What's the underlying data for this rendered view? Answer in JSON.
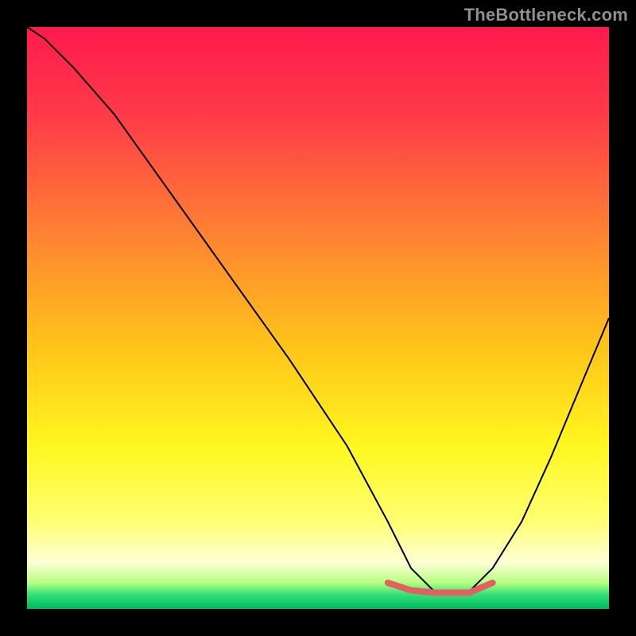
{
  "watermark": "TheBottleneck.com",
  "chart_data": {
    "type": "line",
    "title": "",
    "xlabel": "",
    "ylabel": "",
    "xlim": [
      0,
      100
    ],
    "ylim": [
      0,
      100
    ],
    "background_gradient": {
      "stops": [
        {
          "offset": 0.0,
          "color": "#ff1a4d"
        },
        {
          "offset": 0.15,
          "color": "#ff3a49"
        },
        {
          "offset": 0.35,
          "color": "#ff8033"
        },
        {
          "offset": 0.55,
          "color": "#ffc41a"
        },
        {
          "offset": 0.72,
          "color": "#fff71f"
        },
        {
          "offset": 0.85,
          "color": "#ffff73"
        },
        {
          "offset": 0.92,
          "color": "#ffffd6"
        },
        {
          "offset": 0.955,
          "color": "#b6ff80"
        },
        {
          "offset": 0.975,
          "color": "#33e07a"
        },
        {
          "offset": 1.0,
          "color": "#00b85c"
        }
      ]
    },
    "series": [
      {
        "name": "bottleneck-curve",
        "color": "#000000",
        "width": 2,
        "x": [
          0,
          3,
          8,
          15,
          25,
          35,
          45,
          55,
          62,
          66,
          70,
          76,
          80,
          85,
          90,
          95,
          100
        ],
        "values": [
          100,
          98,
          93,
          85,
          71,
          57,
          43,
          28,
          15,
          7,
          3,
          3,
          7,
          15,
          26,
          38,
          50
        ]
      },
      {
        "name": "optimal-range-marker",
        "color": "#e26060",
        "width": 8,
        "linecap": "round",
        "x": [
          62,
          66,
          70,
          76,
          80
        ],
        "values": [
          4.5,
          3.2,
          2.8,
          2.8,
          4.5
        ]
      }
    ]
  }
}
